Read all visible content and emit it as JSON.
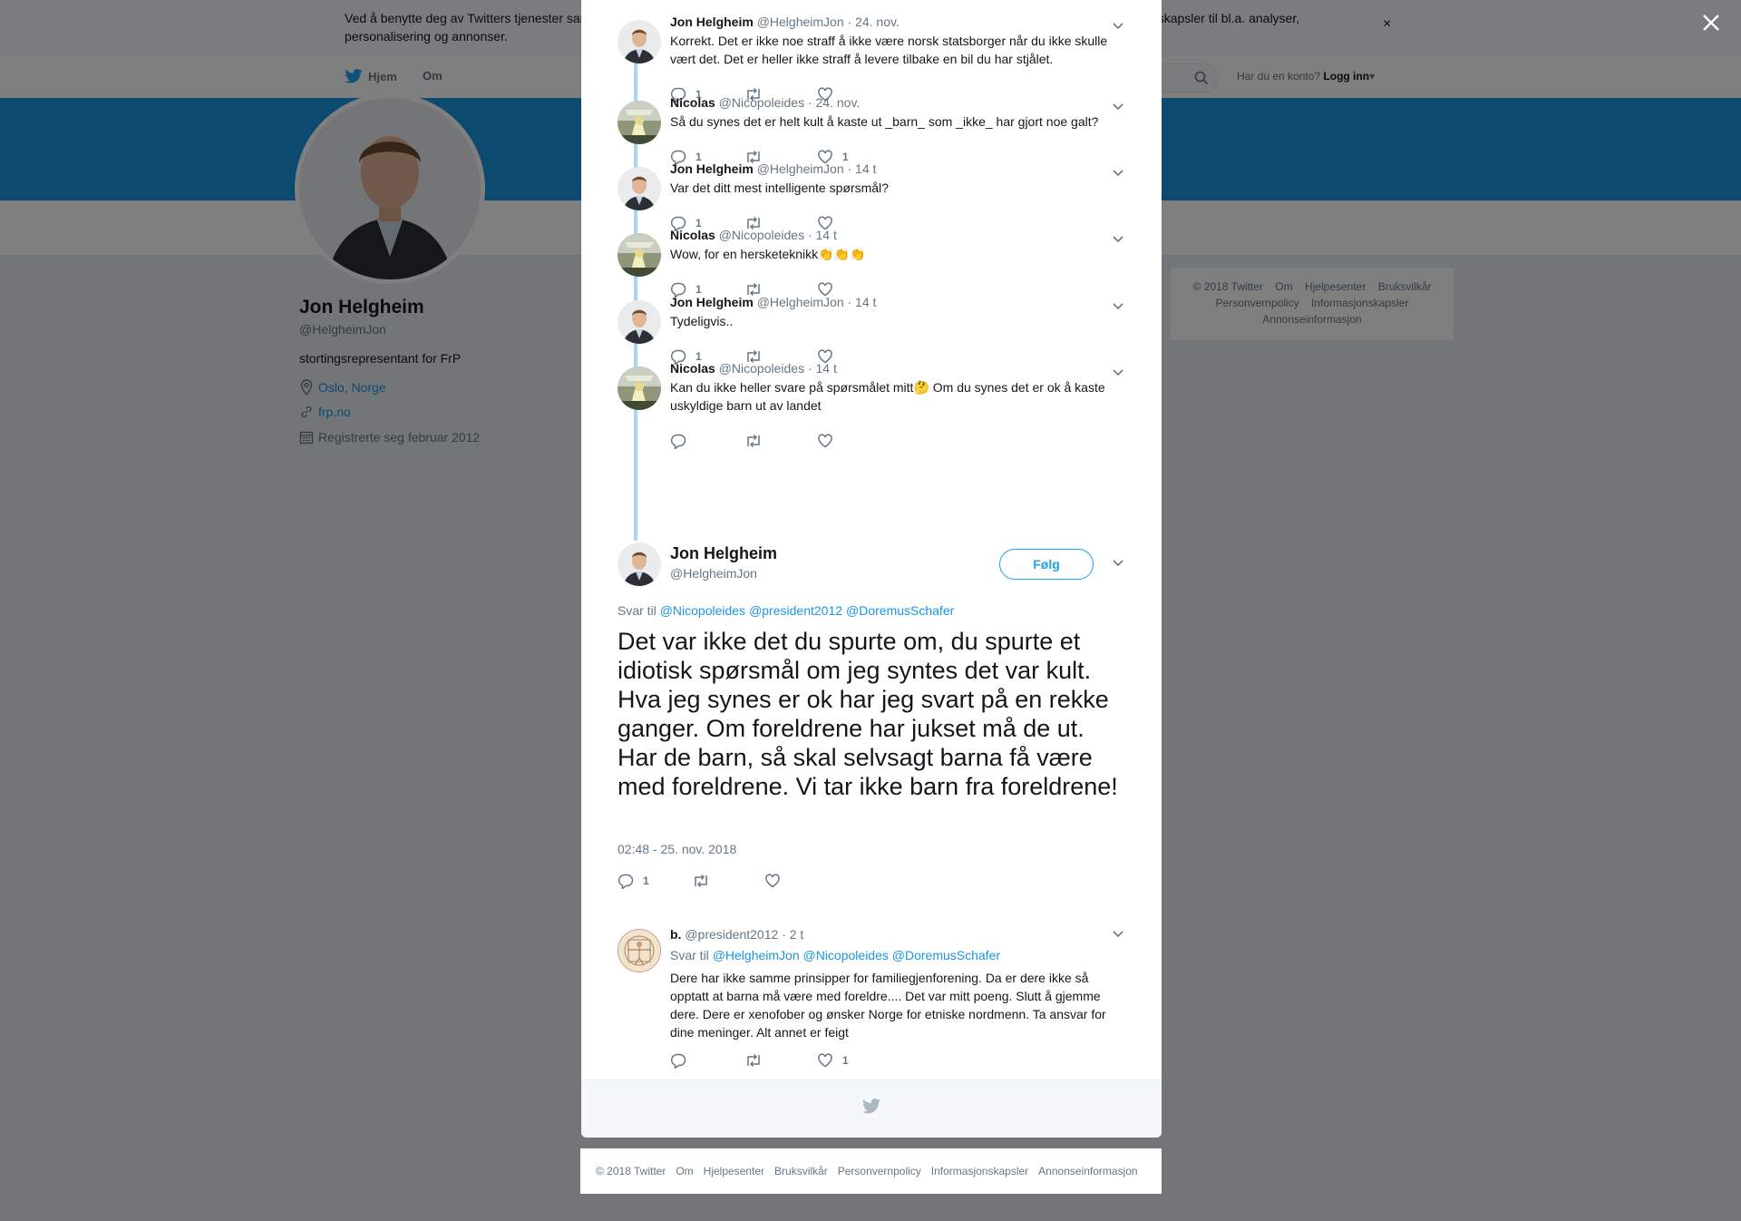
{
  "cookie_banner": {
    "text": "Ved å benytte deg av Twitters tjenester samtykker du i vår bruk av informasjonskapsler. Vi og våre partnere driver globalt og benytter informasjonskapsler til bl.a. analyser, personalisering og annonser.",
    "close": "×"
  },
  "nav": {
    "home": "Hjem",
    "about": "Om",
    "have_account": "Har du en konto?",
    "login": "Logg inn"
  },
  "profile": {
    "name": "Jon Helgheim",
    "handle": "@HelgheimJon",
    "bio": "stortingsrepresentant for FrP",
    "location": "Oslo, Norge",
    "url": "frp.no",
    "joined": "Registrerte seg februar 2012"
  },
  "side_footer": {
    "line1": [
      "© 2018 Twitter",
      "Om",
      "Hjelpesenter",
      "Bruksvilkår"
    ],
    "line2": [
      "Personvernpolicy",
      "Informasjonskapsler"
    ],
    "line3": [
      "Annonseinformasjon"
    ]
  },
  "thread": [
    {
      "name": "Jon Helgheim",
      "handle": "@HelgheimJon",
      "time": "· 24. nov.",
      "text": "Korrekt. Det er ikke noe straff å ikke være norsk statsborger når du ikke skulle vært det. Det er heller ikke straff å levere tilbake en bil du har stjålet.",
      "replies": "1",
      "retweets": "",
      "likes": ""
    },
    {
      "name": "Nicolas",
      "handle": "@Nicopoleides",
      "time": "· 24. nov.",
      "text": "Så du synes det er helt kult å kaste ut _barn_ som _ikke_ har gjort noe galt?",
      "replies": "1",
      "retweets": "",
      "likes": "1"
    },
    {
      "name": "Jon Helgheim",
      "handle": "@HelgheimJon",
      "time": "· 14 t",
      "text": "Var det ditt mest intelligente spørsmål?",
      "replies": "1",
      "retweets": "",
      "likes": ""
    },
    {
      "name": "Nicolas",
      "handle": "@Nicopoleides",
      "time": "· 14 t",
      "text": "Wow, for en hersketeknikk👏👏👏",
      "replies": "1",
      "retweets": "",
      "likes": ""
    },
    {
      "name": "Jon Helgheim",
      "handle": "@HelgheimJon",
      "time": "· 14 t",
      "text": "Tydeligvis..",
      "replies": "1",
      "retweets": "",
      "likes": ""
    },
    {
      "name": "Nicolas",
      "handle": "@Nicopoleides",
      "time": "· 14 t",
      "text": "Kan du ikke heller svare på spørsmålet mitt🤔  Om du synes det er ok å kaste uskyldige barn ut av landet",
      "replies": "",
      "retweets": "",
      "likes": ""
    }
  ],
  "main_tweet": {
    "name": "Jon Helgheim",
    "handle": "@HelgheimJon",
    "follow": "Følg",
    "reply_to_label": "Svar til",
    "mentions": [
      "@Nicopoleides",
      "@president2012",
      "@DoremusSchafer"
    ],
    "text": "Det var ikke det du spurte om, du spurte et idiotisk spørsmål om jeg syntes det var kult. Hva jeg synes er ok har jeg svart på en rekke ganger. Om foreldrene har jukset må de ut. Har de barn, så skal selvsagt barna få være med foreldrene. Vi tar ikke barn fra foreldrene!",
    "date": "02:48 - 25. nov. 2018",
    "replies": "1",
    "retweets": "",
    "likes": ""
  },
  "reply_tweet": {
    "name": "b.",
    "handle": "@president2012",
    "time": "· 2 t",
    "reply_to_label": "Svar til",
    "mentions": [
      "@HelgheimJon",
      "@Nicopoleides",
      "@DoremusSchafer"
    ],
    "text": "Dere har ikke samme prinsipper for familiegjenforening. Da er dere ikke så opptatt at barna må være med foreldre.... Det var mitt poeng. Slutt å gjemme dere. Dere er xenofober og ønsker Norge for etniske nordmenn. Ta ansvar for dine meninger. Alt annet er feigt",
    "replies": "",
    "retweets": "",
    "likes": "1"
  },
  "page_footer": [
    "© 2018 Twitter",
    "Om",
    "Hjelpesenter",
    "Bruksvilkår",
    "Personvernpolicy",
    "Informasjonskapsler",
    "Annonseinformasjon"
  ],
  "colors": {
    "brand": "#1da1f2",
    "banner": "#1b95e0",
    "thread_line": "#a8d7f5",
    "link": "#1b95e0"
  },
  "icons": [
    "twitter-bird-icon",
    "search-icon",
    "location-icon",
    "link-icon",
    "calendar-icon",
    "reply-icon",
    "retweet-icon",
    "like-icon",
    "chevron-down-icon",
    "close-icon"
  ]
}
